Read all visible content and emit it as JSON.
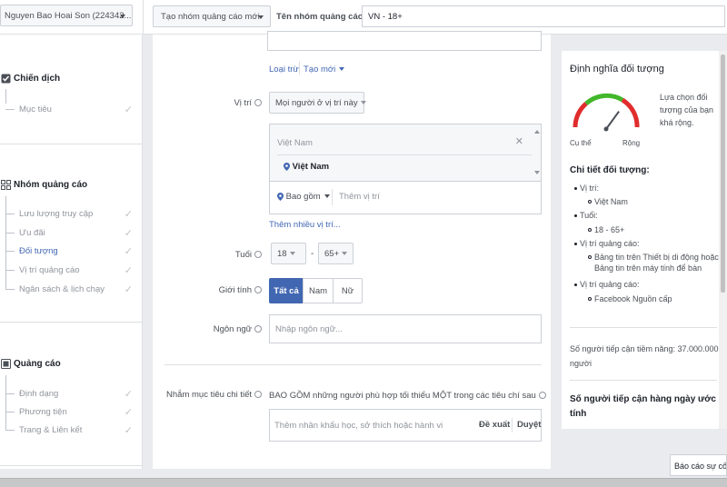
{
  "header": {
    "account": "Nguyen Bao Hoai Son (224342...",
    "create_new": "Tạo nhóm quảng cáo mới",
    "adset_name_label": "Tên nhóm quảng cáo",
    "adset_name_value": "VN - 18+"
  },
  "sidebar": {
    "campaign": {
      "title": "Chiến dịch",
      "items": [
        {
          "label": "Mục tiêu"
        }
      ]
    },
    "adset": {
      "title": "Nhóm quảng cáo",
      "items": [
        {
          "label": "Lưu lượng truy cập"
        },
        {
          "label": "Ưu đãi"
        },
        {
          "label": "Đối tượng",
          "active": true
        },
        {
          "label": "Vị trí quảng cáo"
        },
        {
          "label": "Ngân sách & lịch chạy"
        }
      ]
    },
    "ad": {
      "title": "Quảng cáo",
      "items": [
        {
          "label": "Định dạng"
        },
        {
          "label": "Phương tiện"
        },
        {
          "label": "Trang & Liên kết"
        }
      ]
    },
    "check_glyph": "✓"
  },
  "audience": {
    "exclude_link": "Loại trừ",
    "create_new_link": "Tạo mới",
    "location_label": "Vị trí",
    "location_dropdown": "Mọi người ở vị trí này",
    "country_header": "Việt Nam",
    "location_selected": "Việt Nam",
    "include_dropdown": "Bao gồm",
    "location_placeholder": "Thêm vị trí",
    "bulk_link": "Thêm nhiều vị trí...",
    "age_label": "Tuổi",
    "age_min": "18",
    "age_max": "65+",
    "age_dash": "-",
    "gender_label": "Giới tính",
    "gender_options": [
      "Tất cả",
      "Nam",
      "Nữ"
    ],
    "language_label": "Ngôn ngữ",
    "language_placeholder": "Nhập ngôn ngữ...",
    "detailed_label": "Nhắm mục tiêu chi tiết",
    "detailed_desc": "BAO GỒM những người phù hợp tối thiểu MỘT trong các tiêu chí sau",
    "detailed_placeholder": "Thêm nhân khẩu học, sở thích hoặc hành vi",
    "suggest": "Đề xuất",
    "browse": "Duyệt"
  },
  "definition": {
    "title": "Định nghĩa đối tượng",
    "gauge_desc": "Lựa chọn đối tượng của bạn khá rộng.",
    "specific": "Cụ thể",
    "broad": "Rộng",
    "gauge_level": 0.7,
    "details_title": "Chi tiết đối tượng:",
    "details": [
      {
        "label": "Vị trí:",
        "sub": [
          "Việt Nam"
        ]
      },
      {
        "label": "Tuổi:",
        "sub": [
          "18 - 65+"
        ]
      },
      {
        "label": "Vị trí quảng cáo:",
        "sub": [
          "Bảng tin trên Thiết bị di động hoặc",
          "Bảng tin trên máy tính để bàn"
        ]
      },
      {
        "label": "Vị trí quảng cáo:",
        "sub": [
          "Facebook Nguồn cấp"
        ]
      }
    ],
    "potential_reach": "Số người tiếp cận tiềm năng: 37.000.000 người",
    "daily_reach_title": "Số người tiếp cận hàng ngày ước tính"
  },
  "footer": {
    "report_button": "Báo cáo sự cố"
  },
  "colors": {
    "primary": "#4267b2",
    "gauge_red": "#e02c2c",
    "gauge_green": "#42b72a"
  }
}
